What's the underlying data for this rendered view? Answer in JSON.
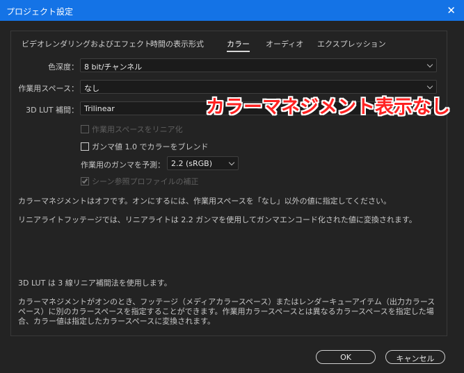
{
  "window": {
    "title": "プロジェクト設定",
    "close_symbol": "✕"
  },
  "tabs": [
    {
      "label": "ビデオレンダリングおよびエフェクト",
      "active": false
    },
    {
      "label": "時間の表示形式",
      "active": false
    },
    {
      "label": "カラー",
      "active": true
    },
    {
      "label": "オーディオ",
      "active": false
    },
    {
      "label": "エクスプレッション",
      "active": false
    }
  ],
  "color": {
    "bit_depth_label": "色深度：",
    "bit_depth_value": "8 bit/チャンネル",
    "working_space_label": "作業用スペース：",
    "working_space_value": "なし",
    "lut_label": "3D LUT 補間：",
    "lut_value": "Trilinear",
    "linearize_label": "作業用スペースをリニア化",
    "linearize_checked": false,
    "linearize_disabled": true,
    "blend_gamma_label": "ガンマ値 1.0 でカラーをブレンド",
    "blend_gamma_checked": false,
    "blend_gamma_disabled": false,
    "predict_gamma_label": "作業用のガンマを予測：",
    "predict_gamma_value": "2.2 (sRGB)",
    "scene_profile_label": "シーン参照プロファイルの補正",
    "scene_profile_checked": true,
    "scene_profile_disabled": true
  },
  "info": {
    "p1": "カラーマネジメントはオフです。オンにするには、作業用スペースを「なし」以外の値に指定してください。",
    "p2": "リニアライトフッテージでは、リニアライトは 2.2 ガンマを使用してガンマエンコード化された値に変換されます。",
    "p3": "3D LUT は 3 線リニア補間法を使用します。",
    "p4": "カラーマネジメントがオンのとき、フッテージ（メディアカラースペース）またはレンダーキューアイテム（出力カラースペース）に別のカラースペースを指定することができます。作業用カラースペースとは異なるカラースペースを指定した場合、カラー値は指定したカラースペースに変換されます。"
  },
  "annotation": {
    "text": "カラーマネジメント表示なし",
    "color": "#ff2121"
  },
  "buttons": {
    "ok": "OK",
    "cancel": "キャンセル"
  },
  "colors": {
    "titlebar": "#1473e6",
    "background": "#232323"
  }
}
